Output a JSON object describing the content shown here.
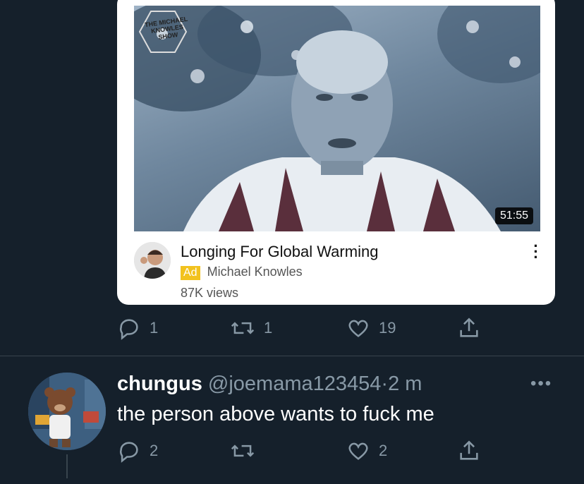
{
  "video_card": {
    "show_logo": "THE MICHAEL KNOWLES SHOW",
    "duration": "51:55",
    "title": "Longing For Global Warming",
    "ad_badge": "Ad",
    "channel": "Michael Knowles",
    "views": "87K views",
    "menu_icon": "more-vertical-icon"
  },
  "tweet1_actions": {
    "reply_count": "1",
    "retweet_count": "1",
    "like_count": "19"
  },
  "tweet2": {
    "name": "chungus",
    "handle": "@joemama123454",
    "separator": "·",
    "time": "2 m",
    "text": "the person above wants to fuck me",
    "reply_count": "2",
    "retweet_count": "",
    "like_count": "2",
    "more": "•••"
  },
  "icons": [
    "reply-icon",
    "retweet-icon",
    "like-icon",
    "share-icon",
    "more-horizontal-icon"
  ],
  "colors": {
    "background": "#15202b",
    "muted": "#8899a6",
    "divider": "#38444d",
    "ad": "#f2c21e"
  }
}
